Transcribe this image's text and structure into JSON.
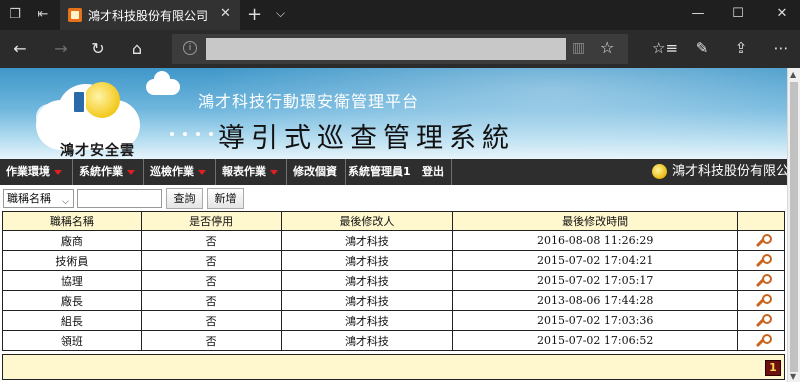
{
  "browser": {
    "tab_title": "鴻才科技股份有限公司",
    "tab_close": "✕",
    "new_tab": "+",
    "tab_menu": "⌵",
    "window": {
      "minimize": "—",
      "maximize": "☐",
      "close": "✕"
    },
    "nav": {
      "back": "←",
      "forward": "→",
      "refresh": "↻",
      "home": "⌂"
    },
    "address_info": "i",
    "address_value": "",
    "reading_icon": "▥",
    "favorite_icon": "☆",
    "actions": {
      "favorites": "☆≡",
      "notes": "✎",
      "share": "⇪",
      "more": "⋯"
    },
    "tab_icons": [
      "❐",
      "⇤"
    ]
  },
  "banner": {
    "logo_name": "鴻才安全雲",
    "subtitle": "鴻才科技行動環安衛管理平台",
    "title": "導引式巡查管理系統"
  },
  "menu": {
    "items": [
      {
        "label": "作業環境",
        "has_arrow": true
      },
      {
        "label": "系統作業",
        "has_arrow": true
      },
      {
        "label": "巡檢作業",
        "has_arrow": true
      },
      {
        "label": "報表作業",
        "has_arrow": true
      },
      {
        "label": "修改個資",
        "has_arrow": false
      }
    ],
    "user": "系統管理員1",
    "logout": "登出",
    "company": "鴻才科技股份有限公司"
  },
  "toolbar": {
    "select_value": "職稱名稱",
    "search_value": "",
    "query_label": "查詢",
    "add_label": "新增"
  },
  "table": {
    "columns": [
      "職稱名稱",
      "是否停用",
      "最後修改人",
      "最後修改時間",
      ""
    ],
    "rows": [
      {
        "title": "廠商",
        "disabled": "否",
        "modifier": "鴻才科技",
        "time": "2016-08-08 11:26:29"
      },
      {
        "title": "技術員",
        "disabled": "否",
        "modifier": "鴻才科技",
        "time": "2015-07-02 17:04:21"
      },
      {
        "title": "協理",
        "disabled": "否",
        "modifier": "鴻才科技",
        "time": "2015-07-02 17:05:17"
      },
      {
        "title": "廠長",
        "disabled": "否",
        "modifier": "鴻才科技",
        "time": "2013-08-06 17:44:28"
      },
      {
        "title": "組長",
        "disabled": "否",
        "modifier": "鴻才科技",
        "time": "2015-07-02 17:03:36"
      },
      {
        "title": "領班",
        "disabled": "否",
        "modifier": "鴻才科技",
        "time": "2015-07-02 17:06:52"
      }
    ],
    "current_page": "1"
  },
  "colors": {
    "header_bg": "#fff8cf",
    "menu_bg": "#2e2e2e",
    "menu_arrow": "#e02020",
    "page_button": "#6e1010"
  }
}
